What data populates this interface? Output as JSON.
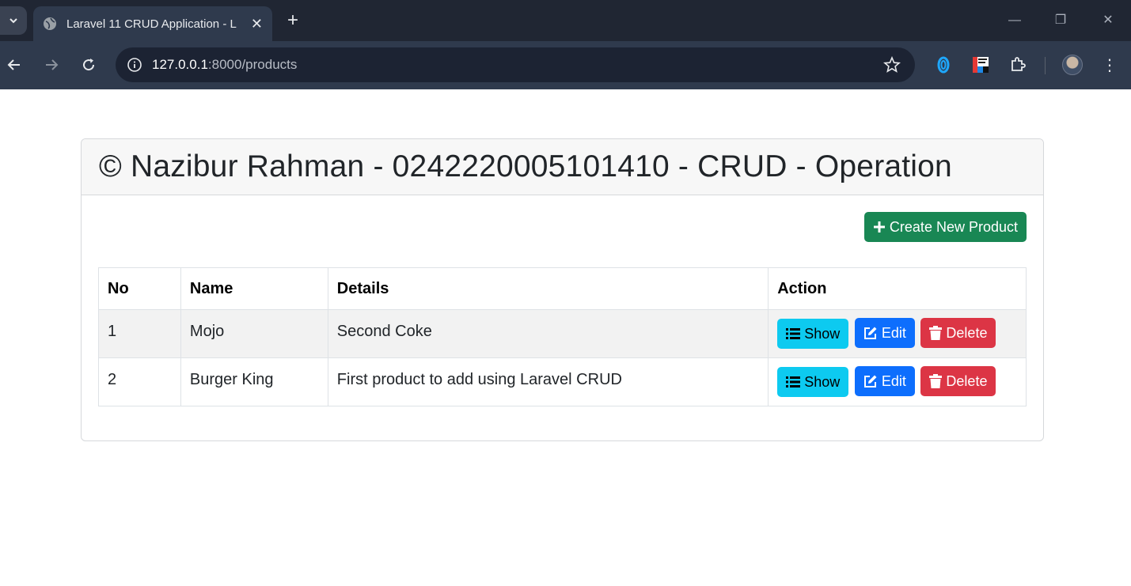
{
  "browser": {
    "tab_title": "Laravel 11 CRUD Application - L",
    "url_host": "127.0.0.1",
    "url_path": ":8000/products",
    "accent": "#202633"
  },
  "page": {
    "heading": "© Nazibur Rahman - 0242220005101410 - CRUD - Operation",
    "create_button": "Create New Product",
    "columns": {
      "no": "No",
      "name": "Name",
      "details": "Details",
      "action": "Action"
    },
    "rows": [
      {
        "no": "1",
        "name": "Mojo",
        "details": "Second Coke",
        "show": "Show",
        "edit": "Edit",
        "delete": "Delete"
      },
      {
        "no": "2",
        "name": "Burger King",
        "details": "First product to add using Laravel CRUD",
        "show": "Show",
        "edit": "Edit",
        "delete": "Delete"
      }
    ],
    "colors": {
      "success": "#198754",
      "info": "#0dcaf0",
      "primary": "#0d6efd",
      "danger": "#dc3545"
    }
  }
}
